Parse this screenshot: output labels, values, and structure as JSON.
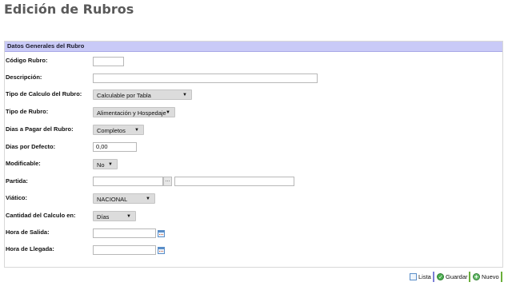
{
  "page": {
    "title": "Edición de Rubros"
  },
  "panel": {
    "header": "Datos Generales del Rubro"
  },
  "fields": {
    "codigo": {
      "label": "Código Rubro:",
      "value": ""
    },
    "descripcion": {
      "label": "Descripción:",
      "value": ""
    },
    "tipo_calculo": {
      "label": "Tipo de Calculo del Rubro:",
      "selected": "Calculable por Tabla"
    },
    "tipo_rubro": {
      "label": "Tipo de Rubro:",
      "selected": "Alimentación y Hospedaje"
    },
    "dias_pagar": {
      "label": "Dias a Pagar del Rubro:",
      "selected": "Completos"
    },
    "dias_defecto": {
      "label": "Dias por Defecto:",
      "value": "0,00"
    },
    "modificable": {
      "label": "Modificable:",
      "selected": "No"
    },
    "partida": {
      "label": "Partida:",
      "code": "",
      "button": "...",
      "description": ""
    },
    "viatico": {
      "label": "Viático:",
      "selected": "NACIONAL"
    },
    "cantidad_calculo": {
      "label": "Cantidad del Calculo en:",
      "selected": "Días"
    },
    "hora_salida": {
      "label": "Hora de Salida:",
      "value": ""
    },
    "hora_llegada": {
      "label": "Hora de Llegada:",
      "value": ""
    }
  },
  "toolbar": {
    "lista": {
      "label": "Lista",
      "icon": "list-icon",
      "color": "#7b7fd6"
    },
    "guardar": {
      "label": "Guardar",
      "icon": "check-icon",
      "color": "#6aaf3a"
    },
    "nuevo": {
      "label": "Nuevo",
      "icon": "plus-icon",
      "color": "#6aaf3a"
    }
  }
}
